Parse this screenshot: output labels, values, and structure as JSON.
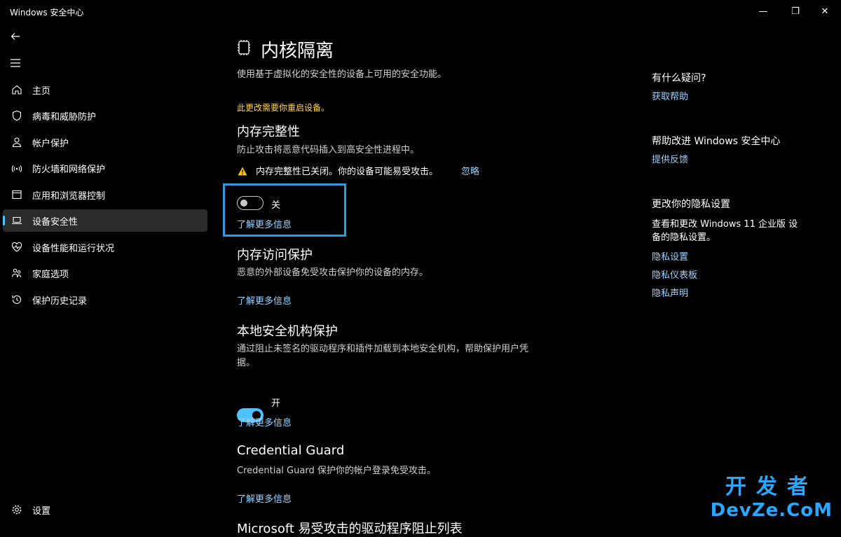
{
  "window": {
    "title": "Windows 安全中心",
    "minimize_glyph": "—",
    "maximize_glyph": "❐",
    "close_glyph": "✕"
  },
  "nav": {
    "back_icon": "back-arrow-icon",
    "menu_icon": "hamburger-menu-icon",
    "items": [
      {
        "label": "主页",
        "icon": "home-icon"
      },
      {
        "label": "病毒和威胁防护",
        "icon": "shield-icon"
      },
      {
        "label": "帐户保护",
        "icon": "person-icon"
      },
      {
        "label": "防火墙和网络保护",
        "icon": "wifi-icon"
      },
      {
        "label": "应用和浏览器控制",
        "icon": "app-window-icon"
      },
      {
        "label": "设备安全性",
        "icon": "laptop-icon",
        "active": true
      },
      {
        "label": "设备性能和运行状况",
        "icon": "heart-pulse-icon"
      },
      {
        "label": "家庭选项",
        "icon": "family-icon"
      },
      {
        "label": "保护历史记录",
        "icon": "history-icon"
      }
    ],
    "settings_label": "设置",
    "accent_color": "#4cc2ff"
  },
  "page": {
    "title": "内核隔离",
    "icon": "chip-icon",
    "subtitle": "使用基于虚拟化的安全性的设备上可用的安全功能。",
    "restart_notice": "此更改需要你重启设备。",
    "sections": {
      "memory_integrity": {
        "title": "内存完整性",
        "desc": "防止攻击将恶意代码插入到高安全性进程中。",
        "warning": "内存完整性已关闭。你的设备可能易受攻击。",
        "dismiss": "忽略",
        "toggle_state": "关",
        "toggle_on": false,
        "learn_more": "了解更多信息"
      },
      "memory_access": {
        "title": "内存访问保护",
        "desc": "恶意的外部设备免受攻击保护你的设备的内存。",
        "learn_more": "了解更多信息"
      },
      "lsa": {
        "title": "本地安全机构保护",
        "desc_line1": "通过阻止未签名的驱动程序和插件加载到本地安全机构，帮助保护用户凭",
        "desc_line2": "据。",
        "toggle_state": "开",
        "toggle_on": true,
        "learn_more": "了解更多信息"
      },
      "credential_guard": {
        "title": "Credential Guard",
        "desc": "Credential Guard 保护你的帐户登录免受攻击。",
        "learn_more": "了解更多信息"
      },
      "blocklist": {
        "title": "Microsoft 易受攻击的驱动程序阻止列表"
      }
    }
  },
  "side": {
    "question_title": "有什么疑问?",
    "get_help": "获取帮助",
    "improve_title": "帮助改进 Windows 安全中心",
    "feedback": "提供反馈",
    "privacy_title": "更改你的隐私设置",
    "privacy_desc_line1": "查看和更改 Windows 11 企业版 设",
    "privacy_desc_line2": "备的隐私设置。",
    "privacy_settings": "隐私设置",
    "privacy_dashboard": "隐私仪表板",
    "privacy_statement": "隐私声明"
  },
  "watermark": {
    "top": "开发者",
    "bottom": "DevZe.CoM"
  }
}
